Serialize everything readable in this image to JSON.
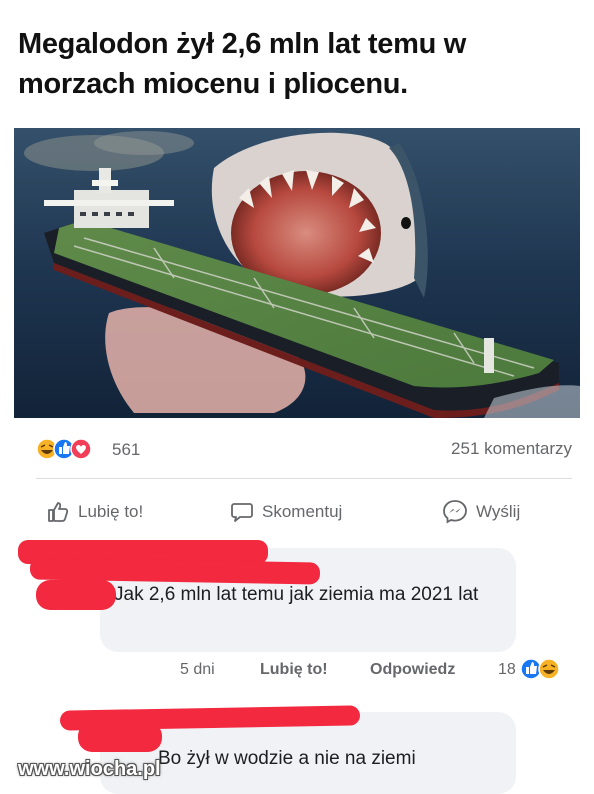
{
  "post": {
    "title": "Megalodon żył 2,6 mln lat temu w morzach miocenu i pliocenu."
  },
  "stats": {
    "reactions_count": "561",
    "comments_count": "251 komentarzy"
  },
  "actions": {
    "like_label": "Lubię to!",
    "comment_label": "Skomentuj",
    "share_label": "Wyślij"
  },
  "comments": [
    {
      "text": "Jak 2,6 mln lat temu jak ziemia ma 2021 lat",
      "time": "5 dni",
      "like_label": "Lubię to!",
      "reply_label": "Odpowiedz",
      "reactions_count": "18"
    },
    {
      "text": "Bo żył w wodzie a nie na ziemi"
    }
  ],
  "watermark": "www.wiocha.pl",
  "colors": {
    "redaction": "#f2293f",
    "comment_bg": "#f0f2f5",
    "secondary_text": "#65676b",
    "like_blue": "#1877f2",
    "love_red": "#f33e58",
    "haha_yellow": "#f7b125"
  }
}
